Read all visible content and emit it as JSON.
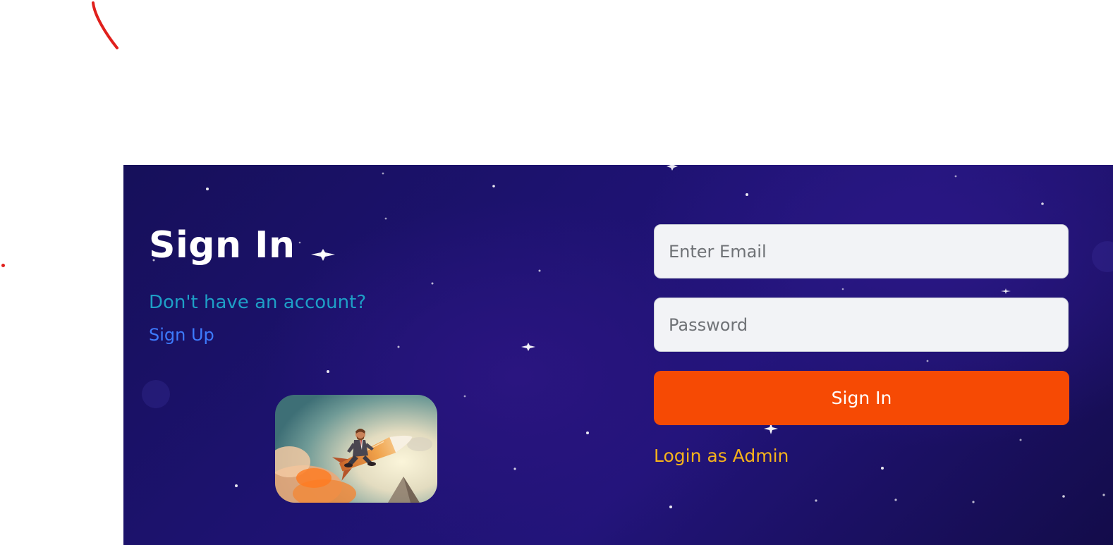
{
  "login": {
    "title": "Sign In",
    "prompt_text": "Don't have an account?",
    "signup_link": "Sign Up",
    "email_placeholder": "Enter Email",
    "password_placeholder": "Password",
    "signin_button": "Sign In",
    "admin_link": "Login as Admin"
  },
  "colors": {
    "panel_background": "#1d1270",
    "signin_button": "#f64a04",
    "prompt_text": "#1e9fc6",
    "signup_link": "#3d7bff",
    "admin_link": "#f6b21b",
    "input_background": "#f2f3f6"
  },
  "icons": {
    "illustration": "businessman-riding-rocket-illustration"
  }
}
